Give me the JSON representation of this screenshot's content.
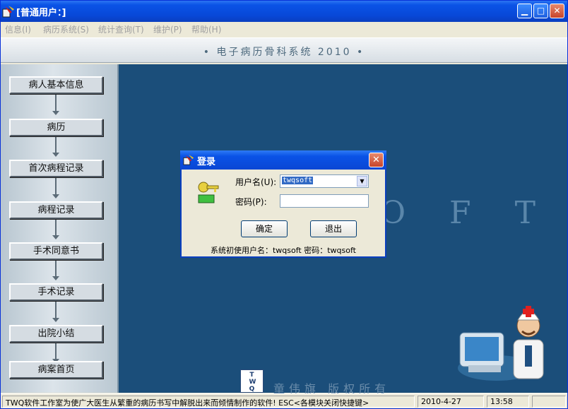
{
  "window": {
    "title": "[普通用户：]"
  },
  "menu": {
    "items": [
      "信息(I)",
      "病历系统(S)",
      "统计查询(T)",
      "维护(P)",
      "帮助(H)"
    ]
  },
  "banner": {
    "title": "• 电子病历骨科系统  2010 •"
  },
  "sidebar": {
    "items": [
      "病人基本信息",
      "病历",
      "首次病程记录",
      "病程记录",
      "手术同意书",
      "手术记录",
      "出院小结",
      "病案首页"
    ]
  },
  "main": {
    "background_text": "O F T",
    "copyright": "童伟旗  版权所有",
    "logo_text": "TWQ"
  },
  "login_dialog": {
    "title": "登录",
    "username_label": "用户名(U):",
    "username_value": "twqsoft",
    "password_label": "密码(P):",
    "confirm_button": "确定",
    "exit_button": "退出",
    "hint": "系统初使用户名：twqsoft 密码：twqsoft"
  },
  "statusbar": {
    "message": "TWQ软件工作室为使广大医生从繁重的病历书写中解脱出来而倾情制作的软件! ESC<各模块关闭快捷键>",
    "date": "2010-4-27",
    "time": "13:58"
  },
  "colors": {
    "main_bg": "#1B4E7A",
    "title_blue": "#0A53E6",
    "sidebar": "#C8D3DB"
  }
}
